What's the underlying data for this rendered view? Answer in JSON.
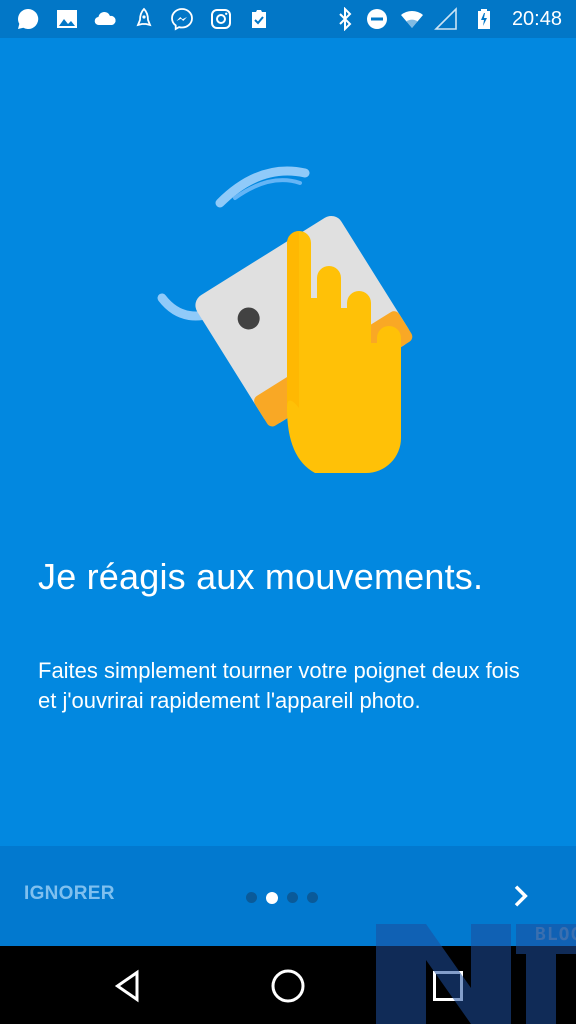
{
  "status_bar": {
    "time": "20:48",
    "left_icons": [
      "chat-bubble-icon",
      "image-icon",
      "cloud-icon",
      "rocket-icon",
      "messenger-icon",
      "instagram-icon",
      "clipboard-check-icon"
    ],
    "right_icons": [
      "bluetooth-icon",
      "do-not-disturb-icon",
      "wifi-icon",
      "signal-icon",
      "battery-charging-icon"
    ]
  },
  "onboarding": {
    "headline": "Je réagis aux mouvements.",
    "body": "Faites simplement tourner votre poignet deux fois et j'ouvrirai rapidement l'appareil photo.",
    "page_count": 4,
    "current_page": 2
  },
  "bottom_bar": {
    "skip_label": "IGNORER"
  },
  "watermark": {
    "text": "BLOG"
  },
  "colors": {
    "background": "#0288e0",
    "status_bar": "#0277c7",
    "bottom_bar": "#0279cf",
    "hand": "#ffc107",
    "phone": "#e0e0e0"
  }
}
